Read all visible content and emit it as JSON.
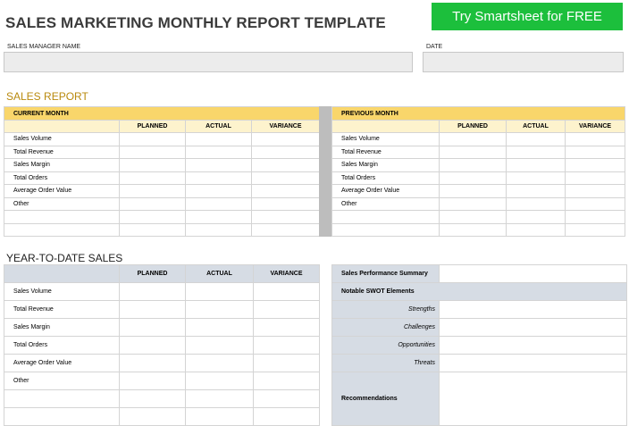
{
  "header": {
    "title": "SALES MARKETING MONTHLY REPORT TEMPLATE",
    "cta_label": "Try Smartsheet for FREE"
  },
  "fields": {
    "manager_label": "SALES MANAGER NAME",
    "manager_value": "",
    "date_label": "DATE",
    "date_value": ""
  },
  "sales_report": {
    "title": "SALES REPORT",
    "current": {
      "band": "CURRENT MONTH",
      "columns": [
        "",
        "PLANNED",
        "ACTUAL",
        "VARIANCE"
      ],
      "rows": [
        "Sales Volume",
        "Total Revenue",
        "Sales Margin",
        "Total Orders",
        "Average Order Value",
        "Other",
        "",
        ""
      ]
    },
    "previous": {
      "band": "PREVIOUS MONTH",
      "columns": [
        "",
        "PLANNED",
        "ACTUAL",
        "VARIANCE"
      ],
      "rows": [
        "Sales Volume",
        "Total Revenue",
        "Sales Margin",
        "Total Orders",
        "Average Order Value",
        "Other",
        "",
        ""
      ]
    }
  },
  "ytd": {
    "title": "YEAR-TO-DATE SALES",
    "columns": [
      "",
      "PLANNED",
      "ACTUAL",
      "VARIANCE"
    ],
    "rows": [
      "Sales Volume",
      "Total Revenue",
      "Sales Margin",
      "Total Orders",
      "Average Order Value",
      "Other",
      "",
      ""
    ]
  },
  "performance": {
    "summary_label": "Sales Performance Summary",
    "swot_label": "Notable SWOT Elements",
    "swot_items": [
      "Strengths",
      "Challenges",
      "Opportunities",
      "Threats"
    ],
    "recommendations_label": "Recommendations"
  },
  "colors": {
    "brand_green": "#1cbf3c",
    "band_yellow": "#f9d66b",
    "header_cream": "#fdf3cd",
    "header_blue_gray": "#d6dce4",
    "section_gold": "#b98a0e"
  }
}
